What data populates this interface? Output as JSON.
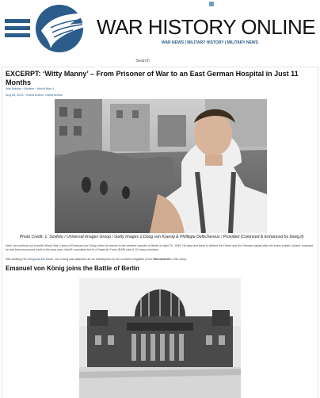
{
  "header": {
    "site_title": "WAR HISTORY ONLINE",
    "tagline": "WAR NEWS | MILITARY HISTORY | MILITARY NEWS"
  },
  "search": {
    "label": "Search"
  },
  "article": {
    "title": "EXCERPT: ‘Witty Manny’ – From Prisoner of War to an East German Hospital in Just 11 Months",
    "breadcrumbs": [
      "War Articles",
      "Modern",
      "World War II"
    ],
    "date": "Aug 28, 2024",
    "author": "Guest Author, Guest Author",
    "caption": "Photo Credit: 1. Sovfoto / Universal Images Group / Getty Images 2.Doug von Koenig & Phillippe Defechereux / Provided (Colorized & Enhanced by Deeg.il)",
    "para1": "Here, we continue our eventful World War II story of Emanuel von König, when he arrives in the western suburbs of Berlin on April 20, 1945. He was sent there to defend his Führer and the German capital after the brave soldier Lühans’ covenant he had been recovered north in the area was. Holm® committed but to a Royal Air Force (RAF) raid of 10 heavy bombers.",
    "para2_prefix": "Still wearing his",
    "para2_link": "Kriegsmarine",
    "para2_mid": "blues, von König was attached as an infantryman to the northern brigades of the",
    "para2_em": "Wehrmacht",
    "para2_suffix": "’s 12th Army.",
    "section_heading": "Emanuel von König joins the Battle of Berlin"
  }
}
